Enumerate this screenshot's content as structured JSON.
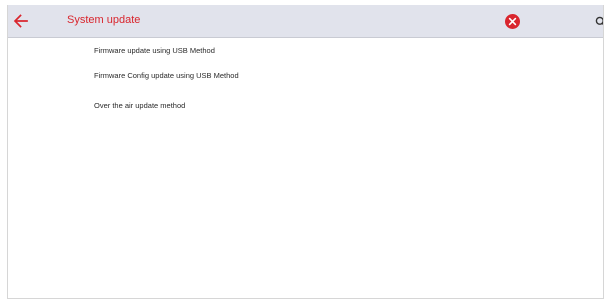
{
  "app": {
    "title": "System update"
  },
  "toolbar": {
    "back_icon": "arrow-left-icon",
    "clear_icon": "close-circle-icon",
    "search_icon": "search-icon"
  },
  "menu": {
    "items": [
      {
        "label": "Firmware update using USB Method"
      },
      {
        "label": "Firmware Config update using USB Method"
      },
      {
        "label": "Over the air update method"
      }
    ]
  },
  "colors": {
    "accent": "#d9262e",
    "toolbar_bg": "#e1e3ec",
    "text": "#2b2b2b"
  }
}
